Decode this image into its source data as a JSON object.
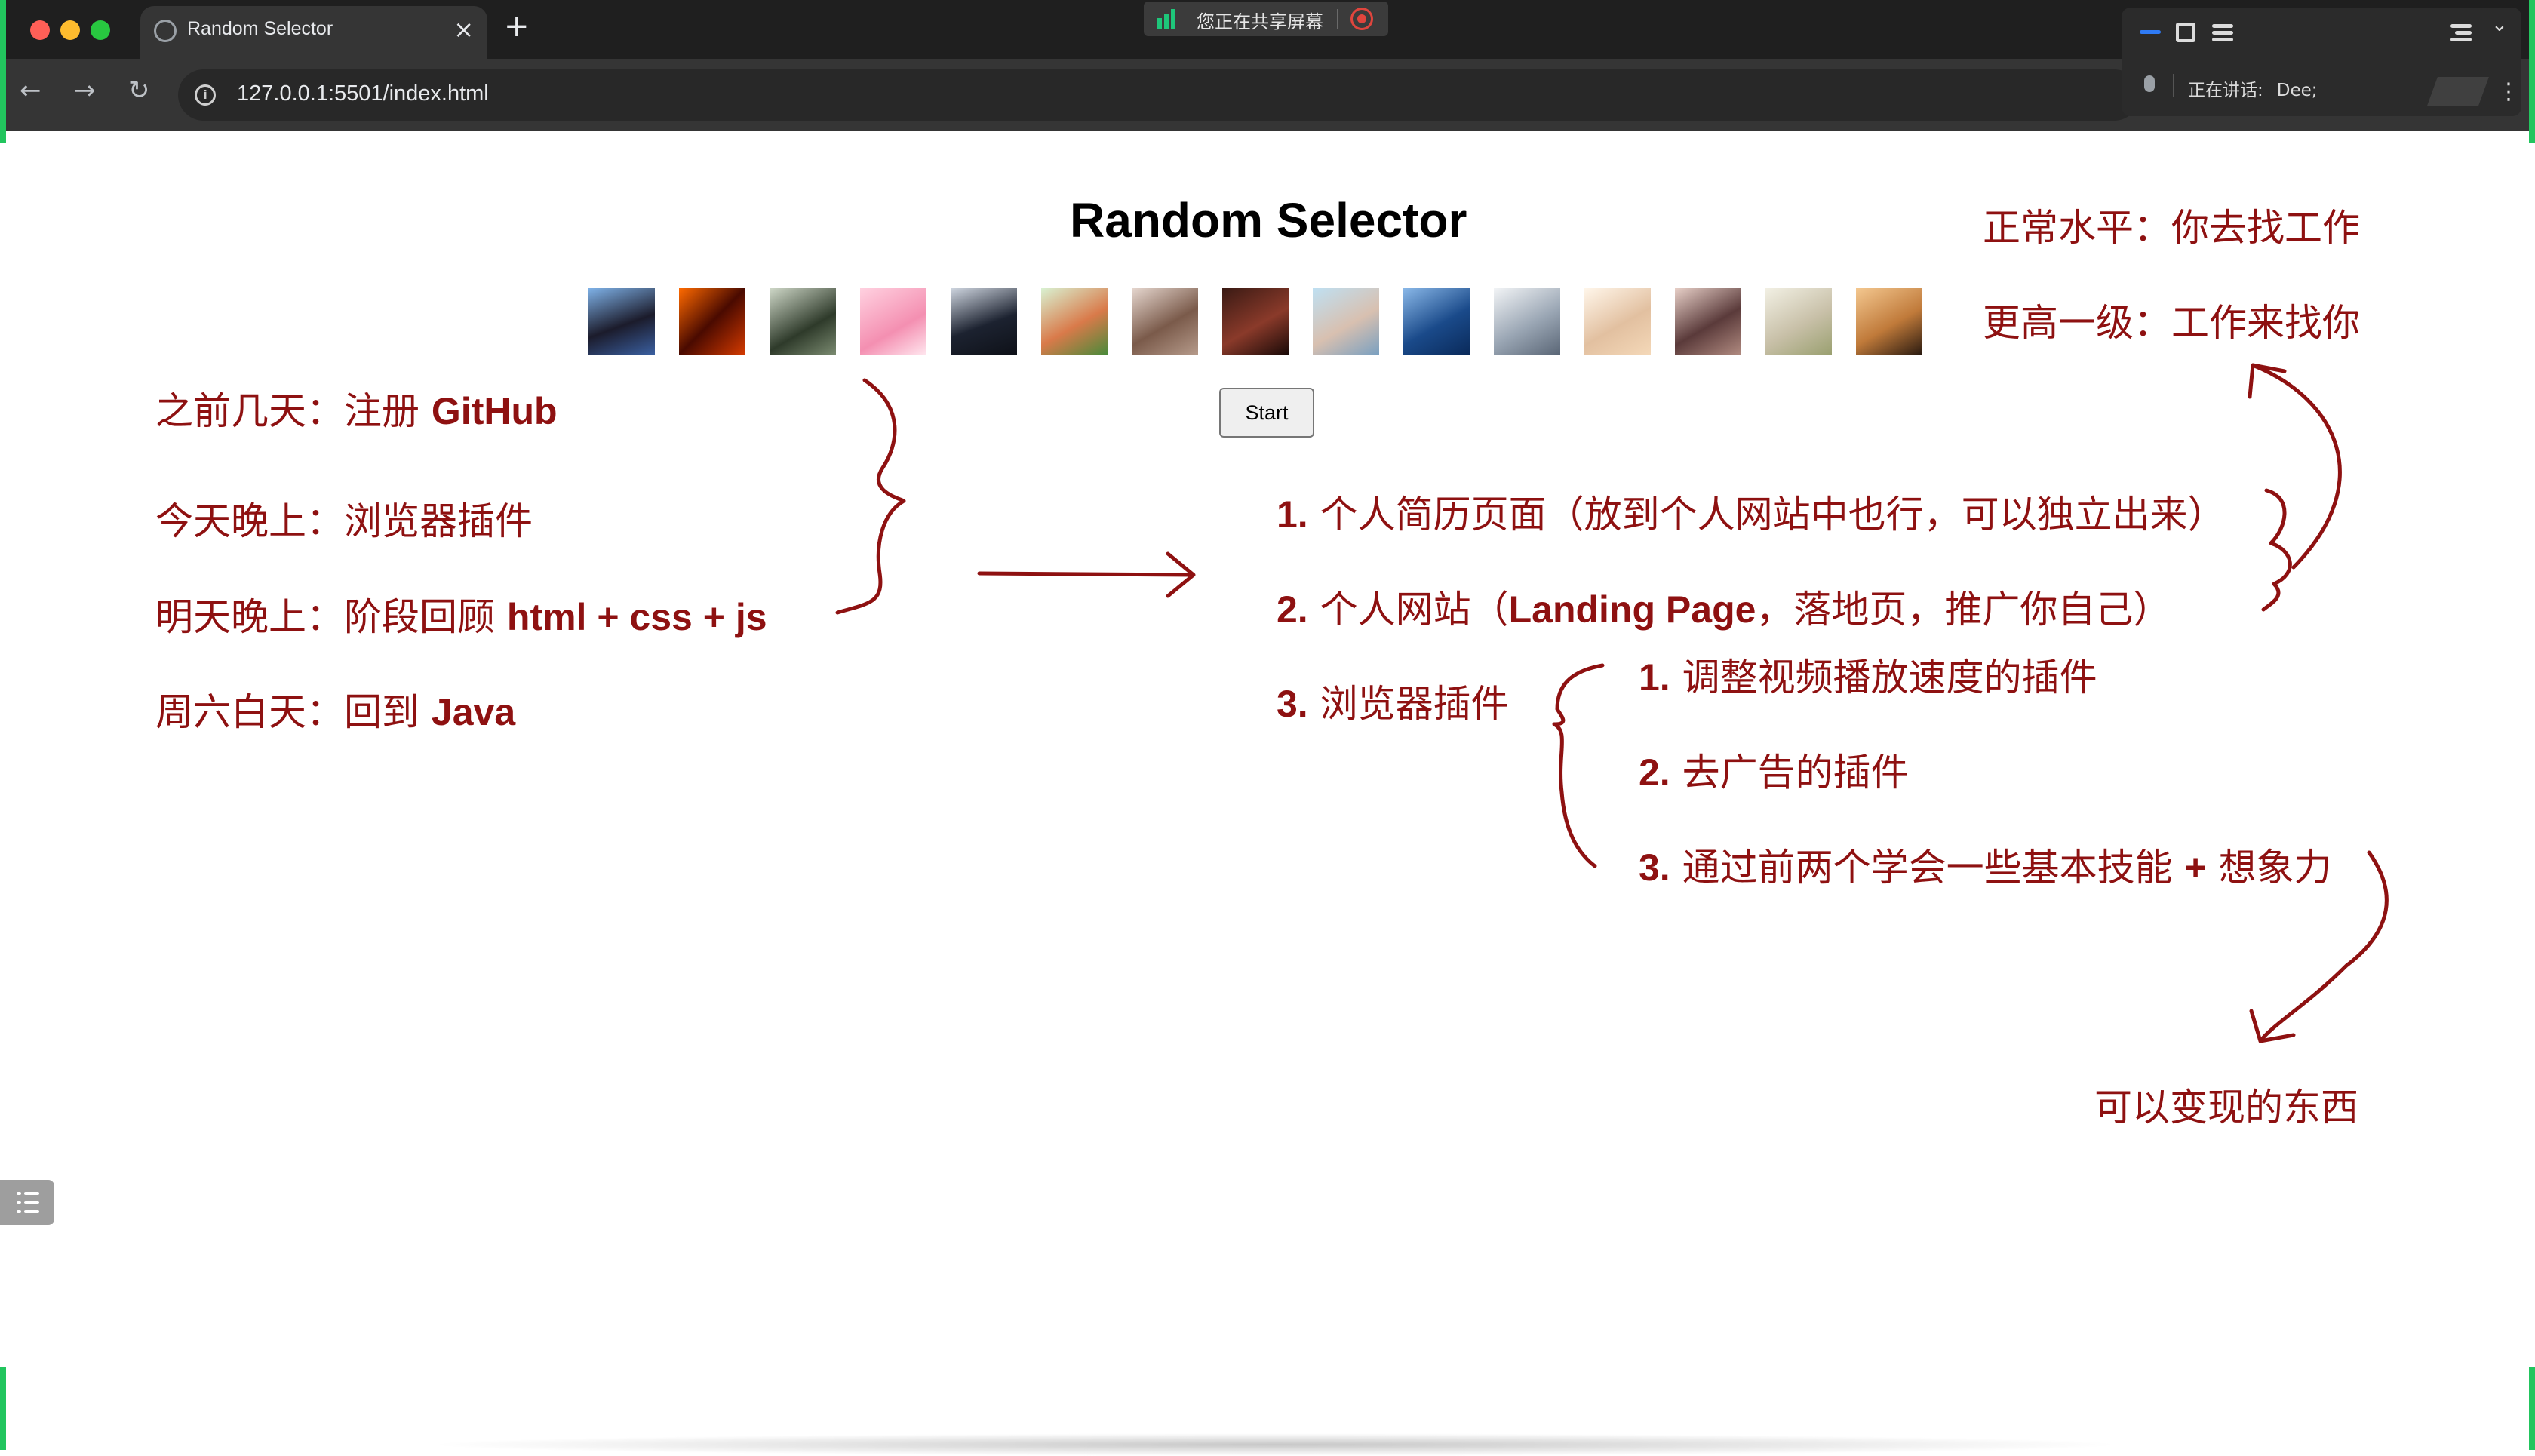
{
  "browser": {
    "tab_title": "Random Selector",
    "close_glyph": "×",
    "new_tab_glyph": "+",
    "url": "127.0.0.1:5501/index.html",
    "share_banner": "您正在共享屏幕",
    "meeting_speaking_label": "正在讲话:",
    "meeting_speaker": "Dee;",
    "more_glyph": "⋮",
    "back_glyph": "←",
    "forward_glyph": "→",
    "reload_glyph": "↻",
    "chevron_glyph": "⌄",
    "info_glyph": "i"
  },
  "page": {
    "title": "Random Selector",
    "start_button": "Start",
    "avatar_count": 15
  },
  "notes": {
    "left": [
      {
        "prefix": "之前几天：注册 ",
        "bold": "GitHub"
      },
      {
        "prefix": "今天晚上：浏览器插件",
        "bold": ""
      },
      {
        "prefix": "明天晚上：阶段回顾 ",
        "bold": "html + css + js"
      },
      {
        "prefix": "周六白天：回到 ",
        "bold": "Java"
      }
    ],
    "right": [
      {
        "num": "1.",
        "text": " 个人简历页面（放到个人网站中也行，可以独立出来）",
        "bold": "",
        "suffix": ""
      },
      {
        "num": "2.",
        "text": " 个人网站（",
        "bold": "Landing Page",
        "suffix": "，落地页，推广你自己）"
      },
      {
        "num": "3.",
        "text": " 浏览器插件",
        "bold": "",
        "suffix": ""
      }
    ],
    "sub": [
      {
        "num": "1.",
        "text": " 调整视频播放速度的插件",
        "bold": ""
      },
      {
        "num": "2.",
        "text": " 去广告的插件",
        "bold": ""
      },
      {
        "num": "3.",
        "text": " 通过前两个学会一些基本技能 ",
        "bold": "+",
        "suffix": " 想象力"
      }
    ],
    "top_right": [
      "正常水平：你去找工作",
      "更高一级：工作来找你"
    ],
    "bottom_right": "可以变现的东西"
  },
  "colors": {
    "ink": "#8e1111",
    "chrome_dark": "#1f1f1f",
    "chrome_bar": "#353535",
    "share_green": "#1ec67a",
    "screen_share_edge": "#22c55e"
  }
}
